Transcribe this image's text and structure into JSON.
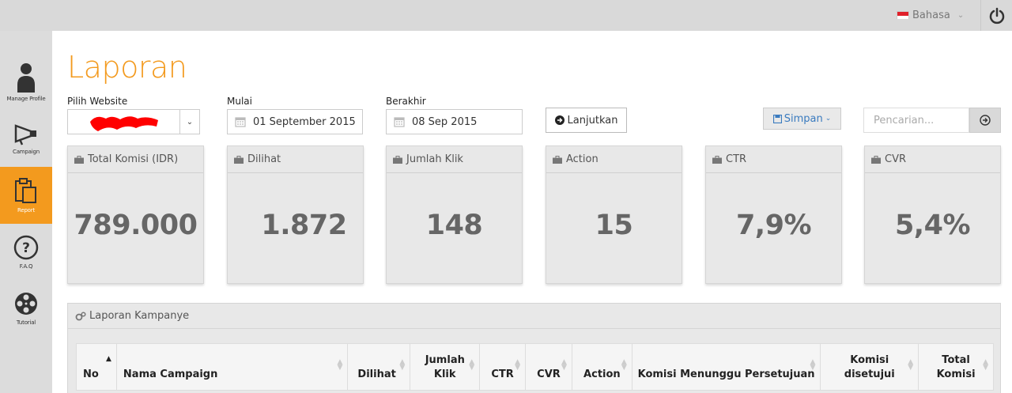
{
  "topbar": {
    "language": "Bahasa"
  },
  "sidebar": {
    "items": [
      {
        "label": "Manage Profile",
        "icon": "user-icon",
        "active": false
      },
      {
        "label": "Campaign",
        "icon": "megaphone-icon",
        "active": false
      },
      {
        "label": "Report",
        "icon": "clipboard-icon",
        "active": true
      },
      {
        "label": "F.A.Q",
        "icon": "question-icon",
        "active": false
      },
      {
        "label": "Tutorial",
        "icon": "film-reel-icon",
        "active": false
      }
    ]
  },
  "page": {
    "title": "Laporan"
  },
  "filters": {
    "website_label": "Pilih Website",
    "start_label": "Mulai",
    "start_value": "01 September 2015",
    "end_label": "Berakhir",
    "end_value": "08 Sep 2015",
    "continue_button": "Lanjutkan",
    "save_button": "Simpan",
    "search_placeholder": "Pencarian..."
  },
  "stats": [
    {
      "label": "Total Komisi (IDR)",
      "value": "789.000"
    },
    {
      "label": "Dilihat",
      "value": "1.872"
    },
    {
      "label": "Jumlah Klik",
      "value": "148"
    },
    {
      "label": "Action",
      "value": "15"
    },
    {
      "label": "CTR",
      "value": "7,9%"
    },
    {
      "label": "CVR",
      "value": "5,4%"
    }
  ],
  "campaign_report": {
    "title": "Laporan Kampanye",
    "columns": [
      "No",
      "Nama Campaign",
      "Dilihat",
      "Jumlah Klik",
      "CTR",
      "CVR",
      "Action",
      "Komisi Menunggu Persetujuan",
      "Komisi disetujui",
      "Total Komisi"
    ]
  },
  "colors": {
    "accent": "#f39a1e",
    "link": "#3a7bbf"
  }
}
